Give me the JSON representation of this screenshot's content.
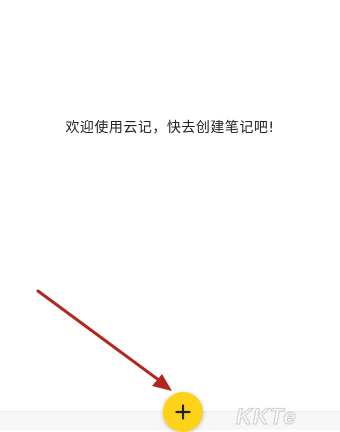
{
  "empty_state": {
    "message": "欢迎使用云记，快去创建笔记吧!"
  },
  "fab": {
    "icon": "plus-icon",
    "color": "#ffd21a"
  },
  "annotation": {
    "arrow_color": "#b3261e"
  },
  "watermark": {
    "text": "KKTe"
  }
}
